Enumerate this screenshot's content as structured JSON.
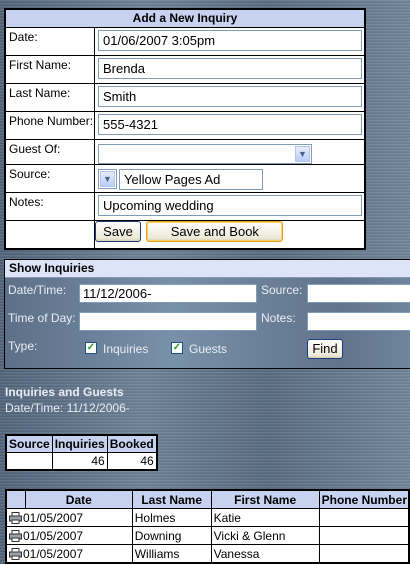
{
  "add_form": {
    "title": "Add a New Inquiry",
    "fields": {
      "date": {
        "label": "Date:",
        "value": "01/06/2007 3:05pm"
      },
      "first_name": {
        "label": "First Name:",
        "value": "Brenda"
      },
      "last_name": {
        "label": "Last Name:",
        "value": "Smith"
      },
      "phone": {
        "label": "Phone Number:",
        "value": "555-4321"
      },
      "guest_of": {
        "label": "Guest Of:",
        "value": ""
      },
      "source": {
        "label": "Source:",
        "value": "Yellow Pages Ad"
      },
      "notes": {
        "label": "Notes:",
        "value": "Upcoming wedding"
      }
    },
    "save_label": "Save",
    "save_book_label": "Save and Book"
  },
  "show_panel": {
    "title": "Show Inquiries",
    "datetime_label": "Date/Time:",
    "datetime_value": "11/12/2006-",
    "source_label": "Source:",
    "source_value": "",
    "timeofday_label": "Time of Day:",
    "timeofday_value": "",
    "notes_label": "Notes:",
    "notes_value": "",
    "type_label": "Type:",
    "inquiries_label": "Inquiries",
    "inquiries_checked": true,
    "guests_label": "Guests",
    "guests_checked": true,
    "find_label": "Find"
  },
  "results": {
    "title": "Inquiries and Guests",
    "subtitle": "Date/Time: 11/12/2006-",
    "summary": {
      "headers": [
        "Source",
        "Inquiries",
        "Booked"
      ],
      "row": [
        "",
        "46",
        "46"
      ]
    },
    "list": {
      "headers": [
        "",
        "Date",
        "Last Name",
        "First Name",
        "Phone Number"
      ],
      "rows": [
        {
          "date": "01/05/2007",
          "last": "Holmes",
          "first": "Katie",
          "phone": ""
        },
        {
          "date": "01/05/2007",
          "last": "Downing",
          "first": "Vicki & Glenn",
          "phone": ""
        },
        {
          "date": "01/05/2007",
          "last": "Williams",
          "first": "Vanessa",
          "phone": ""
        }
      ]
    }
  },
  "icons": {
    "dropdown": "chevron-down-icon",
    "row_action": "printer-icon"
  }
}
